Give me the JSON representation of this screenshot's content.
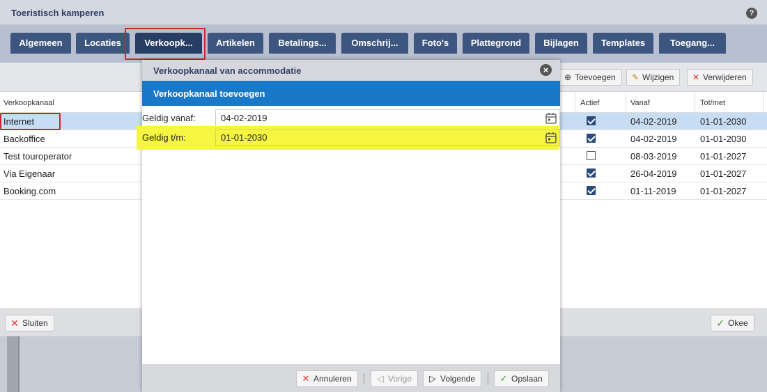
{
  "window": {
    "title": "Toeristisch kamperen",
    "help_label": "?"
  },
  "tabs": [
    {
      "label": "Algemeen"
    },
    {
      "label": "Locaties"
    },
    {
      "label": "Verkoopk..."
    },
    {
      "label": "Artikelen"
    },
    {
      "label": "Betalings..."
    },
    {
      "label": "Omschrij..."
    },
    {
      "label": "Foto's"
    },
    {
      "label": "Plattegrond"
    },
    {
      "label": "Bijlagen"
    },
    {
      "label": "Templates"
    },
    {
      "label": "Toegang..."
    }
  ],
  "toolbar": {
    "add_label": "Toevoegen",
    "edit_label": "Wijzigen",
    "delete_label": "Verwijderen"
  },
  "table": {
    "headers": {
      "channel": "Verkoopkanaal",
      "active": "Actief",
      "from": "Vanaf",
      "to": "Tot/met"
    },
    "rows": [
      {
        "channel": "Internet",
        "active": true,
        "from": "04-02-2019",
        "to": "01-01-2030"
      },
      {
        "channel": "Backoffice",
        "active": true,
        "from": "04-02-2019",
        "to": "01-01-2030"
      },
      {
        "channel": "Test touroperator",
        "active": false,
        "from": "08-03-2019",
        "to": "01-01-2027"
      },
      {
        "channel": "Via Eigenaar",
        "active": true,
        "from": "26-04-2019",
        "to": "01-01-2027"
      },
      {
        "channel": "Booking.com",
        "active": true,
        "from": "01-11-2019",
        "to": "01-01-2027"
      }
    ]
  },
  "footer": {
    "close_label": "Sluiten",
    "ok_label": "Okee"
  },
  "modal": {
    "title": "Verkoopkanaal van accommodatie",
    "subtitle": "Verkoopkanaal toevoegen",
    "valid_from_label": "Geldig vanaf:",
    "valid_from_value": "04-02-2019",
    "valid_to_label": "Geldig t/m:",
    "valid_to_value": "01-01-2030",
    "cancel_label": "Annuleren",
    "prev_label": "Vorige",
    "next_label": "Volgende",
    "save_label": "Opslaan"
  }
}
